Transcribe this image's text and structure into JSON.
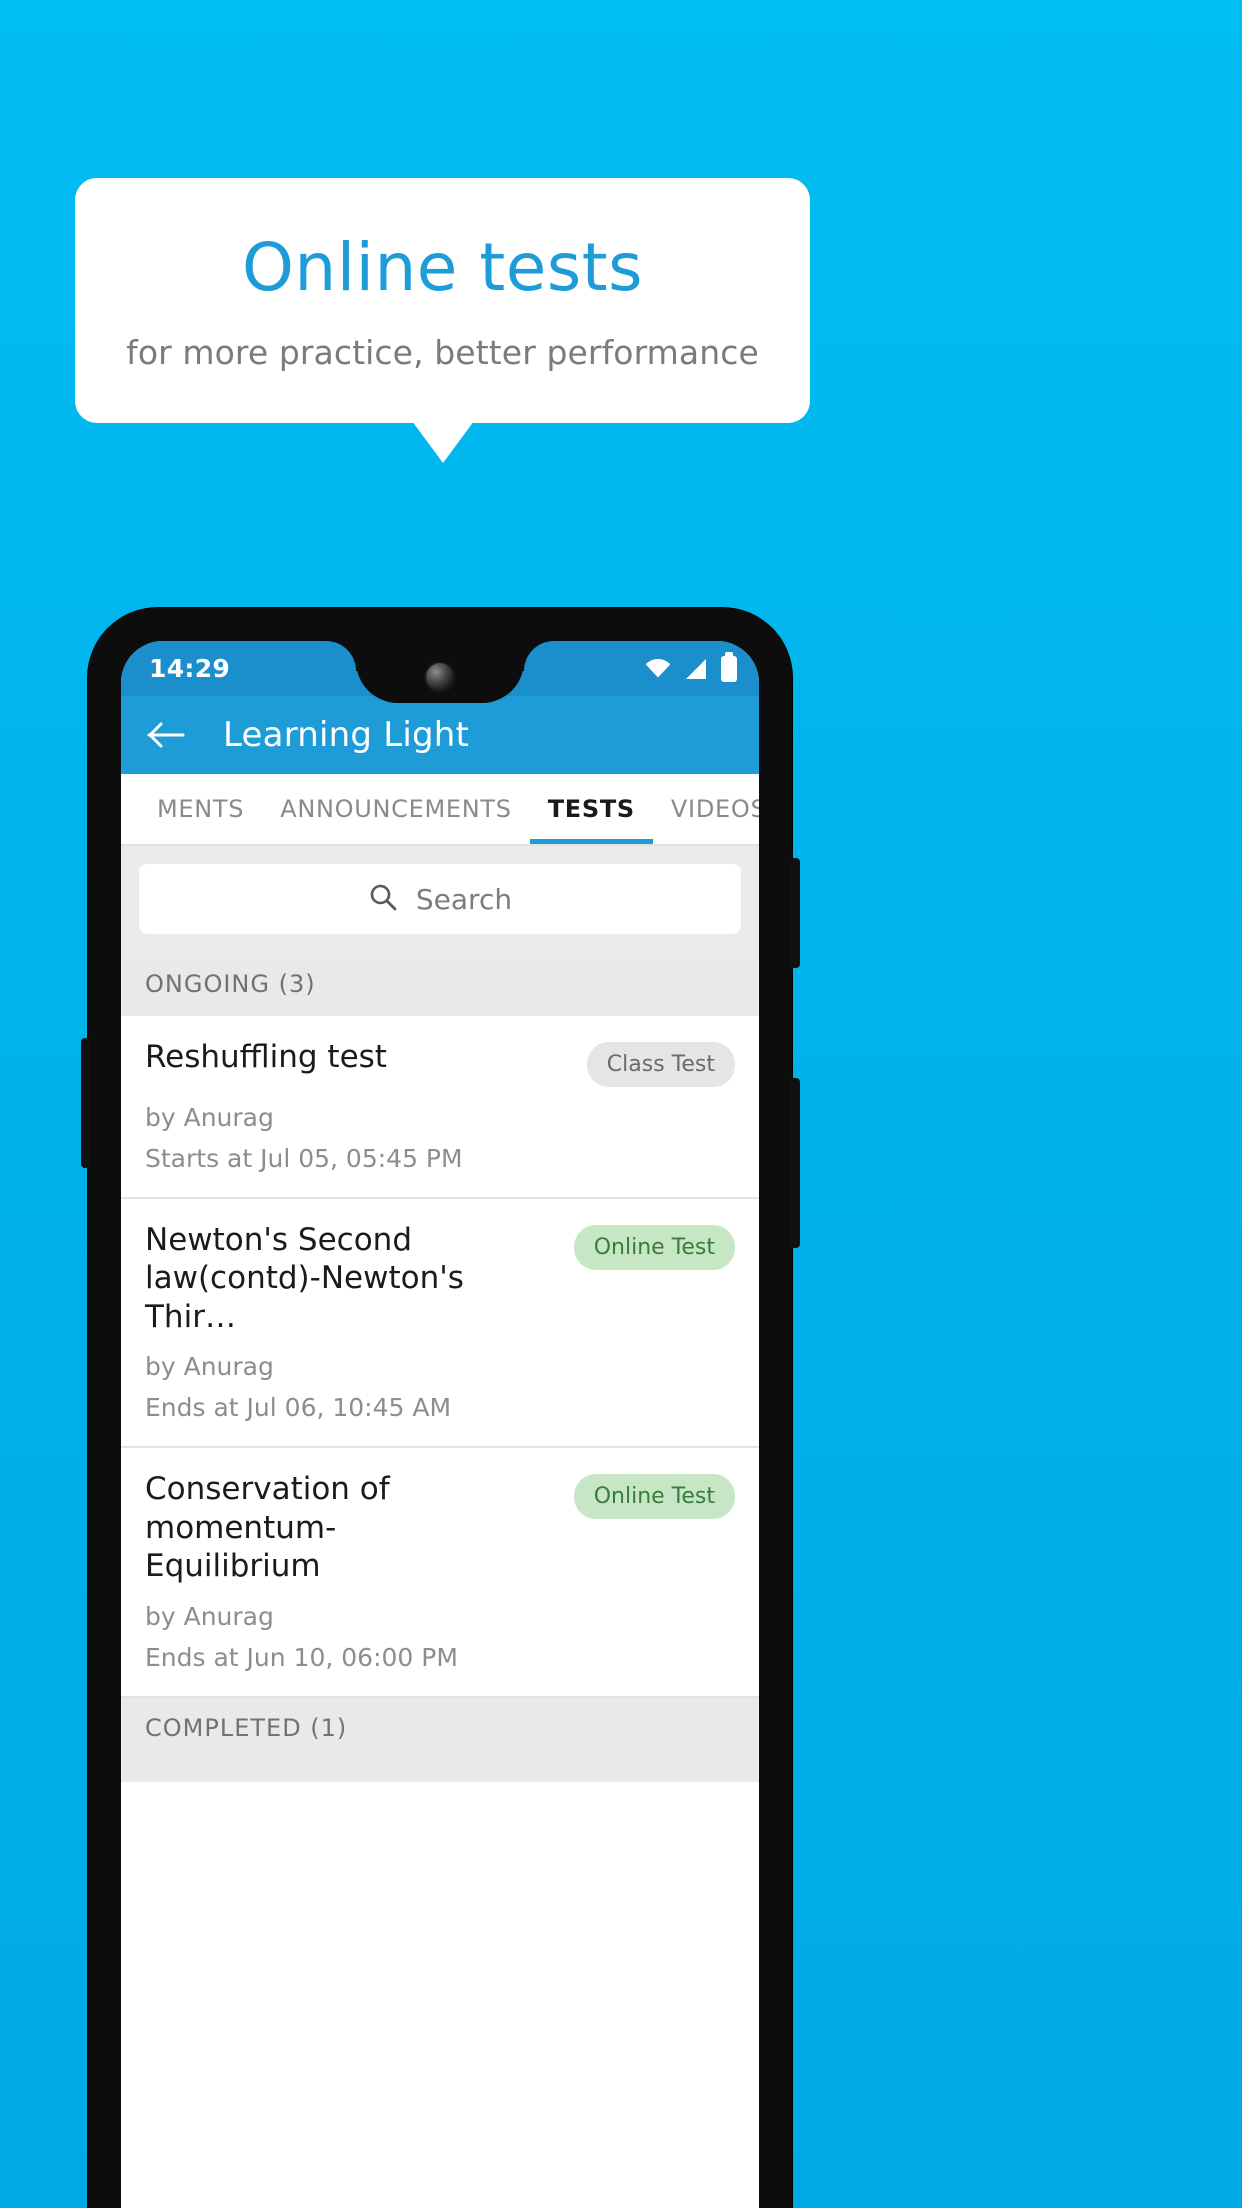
{
  "promo": {
    "title": "Online tests",
    "subtitle": "for more practice, better performance",
    "title_color": "#1e9cd7",
    "subtitle_color": "#7b7b7b",
    "background_color": "#00b5ec",
    "card_color": "#ffffff"
  },
  "device": {
    "status_bar": {
      "time": "14:29",
      "icons": [
        "wifi-icon",
        "signal-icon",
        "battery-icon"
      ],
      "background_color": "#1b8fcc"
    }
  },
  "app": {
    "appbar": {
      "back_icon": "back-arrow-icon",
      "title": "Learning Light",
      "color": "#1e9cd7"
    },
    "tabs": [
      {
        "label": "MENTS",
        "active": false
      },
      {
        "label": "ANNOUNCEMENTS",
        "active": false
      },
      {
        "label": "TESTS",
        "active": true
      },
      {
        "label": "VIDEOS",
        "active": false
      }
    ],
    "search": {
      "icon": "search-icon",
      "placeholder": "Search",
      "value": ""
    },
    "sections": [
      {
        "header": "ONGOING (3)",
        "items": [
          {
            "title": "Reshuffling test",
            "badge": "Class Test",
            "badge_type": "class",
            "author": "by Anurag",
            "schedule_label": "Starts at",
            "schedule_value": "Jul 05, 05:45 PM",
            "schedule": "Starts at  Jul 05, 05:45 PM"
          },
          {
            "title": "Newton's Second law(contd)-Newton's Thir…",
            "badge": "Online Test",
            "badge_type": "online",
            "author": "by Anurag",
            "schedule_label": "Ends at",
            "schedule_value": "Jul 06, 10:45 AM",
            "schedule": "Ends at  Jul 06, 10:45 AM"
          },
          {
            "title": "Conservation of momentum-Equilibrium",
            "badge": "Online Test",
            "badge_type": "online",
            "author": "by Anurag",
            "schedule_label": "Ends at",
            "schedule_value": "Jun 10, 06:00 PM",
            "schedule": "Ends at  Jun 10, 06:00 PM"
          }
        ]
      },
      {
        "header": "COMPLETED (1)",
        "items": []
      }
    ]
  }
}
